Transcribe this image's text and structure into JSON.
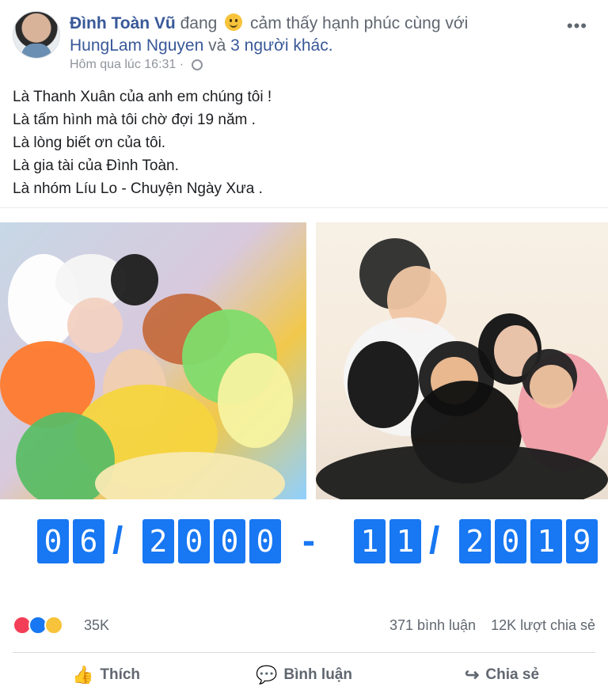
{
  "post": {
    "author": "Đình Toàn Vũ",
    "feeling_prefix": "đang",
    "feeling_text": "cảm thấy hạnh phúc cùng với",
    "tagged_person": "HungLam Nguyen",
    "tagged_suffix": "và",
    "others_link": "3 người khác.",
    "timestamp": "Hôm qua lúc 16:31",
    "privacy_icon": "globe-icon",
    "text_lines": [
      "Là Thanh Xuân của anh em chúng tôi !",
      "Là tấm hình mà tôi chờ đợi 19 năm .",
      "Là lòng biết ơn của tôi.",
      "Là gia tài của Đình Toàn.",
      "Là nhóm Líu Lo - Chuyện Ngày Xưa ."
    ],
    "image_date_start": "06/2000",
    "image_date_end": "11/2019"
  },
  "stats": {
    "reaction_count": "35K",
    "comments": "371 bình luận",
    "shares": "12K lượt chia sẻ"
  },
  "actions": {
    "like": "Thích",
    "comment": "Bình luận",
    "share": "Chia sẻ"
  },
  "colors": {
    "accent": "#1877f2",
    "link": "#385898",
    "muted": "#606770"
  }
}
